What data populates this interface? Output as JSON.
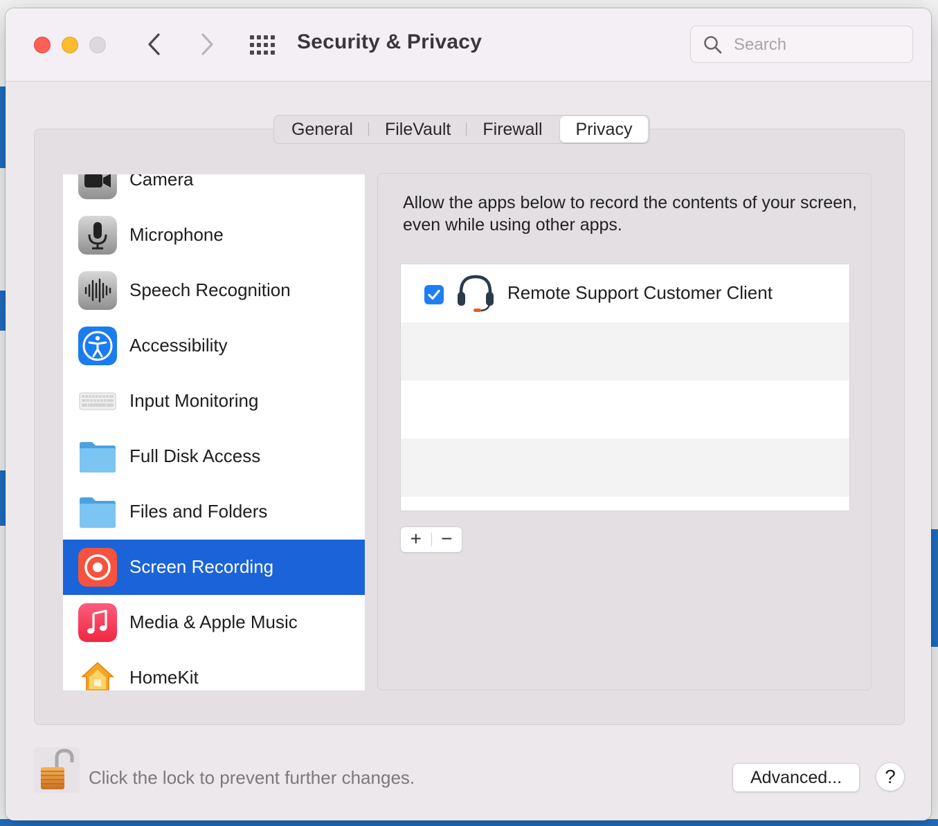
{
  "window": {
    "title": "Security & Privacy",
    "search_placeholder": "Search"
  },
  "tabs": [
    {
      "label": "General"
    },
    {
      "label": "FileVault"
    },
    {
      "label": "Firewall"
    },
    {
      "label": "Privacy",
      "active": true
    }
  ],
  "sidebar": {
    "items": [
      {
        "label": "Camera",
        "icon": "camera-icon"
      },
      {
        "label": "Microphone",
        "icon": "microphone-icon"
      },
      {
        "label": "Speech Recognition",
        "icon": "waveform-icon"
      },
      {
        "label": "Accessibility",
        "icon": "accessibility-icon"
      },
      {
        "label": "Input Monitoring",
        "icon": "keyboard-icon"
      },
      {
        "label": "Full Disk Access",
        "icon": "folder-icon"
      },
      {
        "label": "Files and Folders",
        "icon": "folder-icon"
      },
      {
        "label": "Screen Recording",
        "icon": "screen-recording-icon",
        "selected": true
      },
      {
        "label": "Media & Apple Music",
        "icon": "music-icon"
      },
      {
        "label": "HomeKit",
        "icon": "home-icon"
      }
    ]
  },
  "detail": {
    "description": "Allow the apps below to record the contents of your screen, even while using other apps.",
    "apps": [
      {
        "name": "Remote Support Customer Client",
        "checked": true,
        "icon": "headset-icon"
      }
    ],
    "add_label": "+",
    "remove_label": "−"
  },
  "footer": {
    "lock_text": "Click the lock to prevent further changes.",
    "advanced_label": "Advanced...",
    "help_label": "?"
  },
  "colors": {
    "selection": "#1b63d8",
    "checkbox": "#1d7ef5"
  }
}
